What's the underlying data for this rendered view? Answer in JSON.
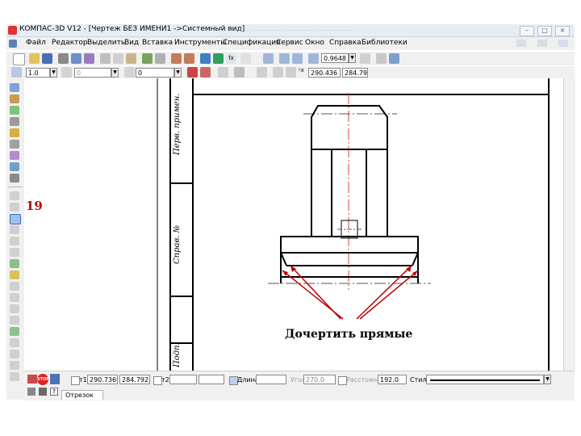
{
  "window": {
    "title": "КОМПАС-3D V12 - [Чертеж БЕЗ ИМЕНИ1 ->Системный вид]",
    "controls": [
      "–",
      "□",
      "×"
    ]
  },
  "menu": {
    "items": [
      "Файл",
      "Редактор",
      "Выделить",
      "Вид",
      "Вставка",
      "Инструменты",
      "Спецификация",
      "Сервис",
      "Окно",
      "Справка",
      "Библиотеки"
    ]
  },
  "toolbar_standard": {
    "zoom_value": "0.9648"
  },
  "toolbar_current_state": {
    "step": "1.0",
    "layer": "0",
    "style": "0",
    "cursor_x": "290.436",
    "cursor_y": "284.79"
  },
  "drawing": {
    "stamp_labels": [
      "Перв. примен.",
      "Справ. №",
      "Подп."
    ]
  },
  "annotations": {
    "step_number": "19",
    "instruction": "Дочертить прямые",
    "colors": {
      "annotation_red": "#c00000",
      "centerline": "#d94040",
      "outline": "#000000"
    }
  },
  "property_bar": {
    "t1_label": "т1",
    "t1_x": "290.7369",
    "t1_y": "284.7925",
    "t2_label": "т2",
    "length_label": "Длина",
    "angle_label": "Угол",
    "angle_value": "270.0",
    "distance_label": "Расстояние",
    "distance_value": "192.0",
    "style_label": "Стиль",
    "stop_label": "STOP",
    "tab_label": "Отрезок"
  }
}
